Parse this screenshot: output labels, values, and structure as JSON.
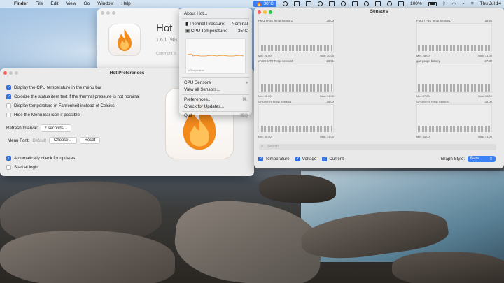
{
  "menubar": {
    "app_name": "Finder",
    "items": [
      "File",
      "Edit",
      "View",
      "Go",
      "Window",
      "Help"
    ],
    "hot_temp": "38°C",
    "battery_percent": "100%",
    "clock": "Thu Jul 14"
  },
  "about_window": {
    "title": "Hot",
    "version": "1.6.1 (90)",
    "copyright": "Copyright ©"
  },
  "prefs_window": {
    "title": "Hot Preferences",
    "options": [
      {
        "label": "Display the CPU temperature in the menu bar",
        "checked": true
      },
      {
        "label": "Colorize the status item text if the thermal pressure is not nominal",
        "checked": true
      },
      {
        "label": "Display temperature in Fahrenheit instead of Celsius",
        "checked": false
      },
      {
        "label": "Hide the Menu Bar icon if possible",
        "checked": false
      }
    ],
    "refresh_label": "Refresh Interval:",
    "refresh_value": "2 seconds",
    "font_label": "Menu Font:",
    "font_value": "Default",
    "choose_label": "Choose...",
    "reset_label": "Reset",
    "auto_update_label": "Automatically check for updates",
    "auto_update_checked": true,
    "login_label": "Start at login",
    "login_checked": false
  },
  "hot_menu": {
    "about": "About Hot...",
    "thermal_label": "Thermal Pressure:",
    "thermal_value": "Nominal",
    "cpu_label": "CPU Temperature:",
    "cpu_value": "35°C",
    "graph_legend": "Temperature",
    "cpu_sensors": "CPU Sensors",
    "view_all": "View all Sensors...",
    "preferences": "Preferences...",
    "preferences_shortcut": "⌘,",
    "check_updates": "Check for Updates...",
    "quit": "Quit",
    "quit_shortcut": "⌘Q"
  },
  "sensors_window": {
    "title": "Sensors",
    "sensors": [
      {
        "name": "PMU TP3S Temp Sensor3",
        "current": "30.00",
        "min": "Min: 28.00",
        "max": "Max: 30.00"
      },
      {
        "name": "PMU TP3S Temp Sensor1",
        "current": "28.54",
        "min": "Min: 28.00",
        "max": "Max: 31.00"
      },
      {
        "name": "eACC MTR Temp Sensor3",
        "current": "28.51",
        "min": "Min: 28.00",
        "max": "Max: 31.00"
      },
      {
        "name": "gas gauge battery",
        "current": "27.80",
        "min": "Min: 27.00",
        "max": "Max: 28.00"
      },
      {
        "name": "GPU MTR Temp Sensor1",
        "current": "30.00",
        "min": "Min: 30.00",
        "max": "Max: 31.00"
      },
      {
        "name": "GPU MTR Temp Sensor4",
        "current": "30.00",
        "min": "Min: 30.00",
        "max": "Max: 31.00"
      }
    ],
    "search_placeholder": "Search",
    "show_temperature": "Temperature",
    "show_voltage": "Voltage",
    "show_current": "Current",
    "graph_style_label": "Graph Style:",
    "graph_style_value": "Bars"
  },
  "colors": {
    "accent": "#2f6fe4",
    "graph_bars": "#f0a13c",
    "flame_orange": "#f28a1c"
  }
}
